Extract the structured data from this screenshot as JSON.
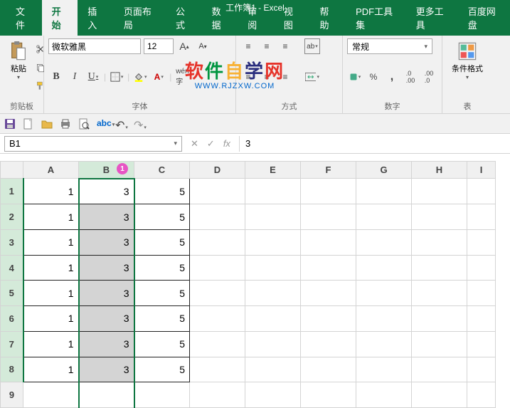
{
  "title": "工作簿1  -  Excel",
  "tabs": [
    "文件",
    "开始",
    "插入",
    "页面布局",
    "公式",
    "数据",
    "审阅",
    "视图",
    "帮助",
    "PDF工具集",
    "更多工具",
    "百度网盘"
  ],
  "active_tab": 1,
  "ribbon": {
    "clipboard": {
      "paste": "粘贴",
      "label": "剪贴板"
    },
    "font": {
      "name": "微软雅黑",
      "size": "12",
      "label": "字体",
      "increase": "A",
      "decrease": "A",
      "bold": "B",
      "italic": "I",
      "underline": "U"
    },
    "alignment": {
      "label": "方式",
      "wrap": "ab"
    },
    "number": {
      "format": "常规",
      "label": "数字",
      "percent": "%",
      "comma": ",",
      "inc_dec": "←0",
      "dec_dec": "→0"
    },
    "styles": {
      "cond_fmt": "条件格式",
      "table": "表"
    }
  },
  "watermark": {
    "line1": "软件自学网",
    "line2": "WWW.RJZXW.COM"
  },
  "namebox": "B1",
  "formula": {
    "fx": "fx",
    "value": "3"
  },
  "columns": [
    "A",
    "B",
    "C",
    "D",
    "E",
    "F",
    "G",
    "H",
    "I"
  ],
  "selected_col": 1,
  "badge": "1",
  "rows": [
    {
      "r": 1,
      "A": "1",
      "B": "3",
      "C": "5"
    },
    {
      "r": 2,
      "A": "1",
      "B": "3",
      "C": "5"
    },
    {
      "r": 3,
      "A": "1",
      "B": "3",
      "C": "5"
    },
    {
      "r": 4,
      "A": "1",
      "B": "3",
      "C": "5"
    },
    {
      "r": 5,
      "A": "1",
      "B": "3",
      "C": "5"
    },
    {
      "r": 6,
      "A": "1",
      "B": "3",
      "C": "5"
    },
    {
      "r": 7,
      "A": "1",
      "B": "3",
      "C": "5"
    },
    {
      "r": 8,
      "A": "1",
      "B": "3",
      "C": "5"
    },
    {
      "r": 9,
      "A": "",
      "B": "",
      "C": ""
    }
  ]
}
